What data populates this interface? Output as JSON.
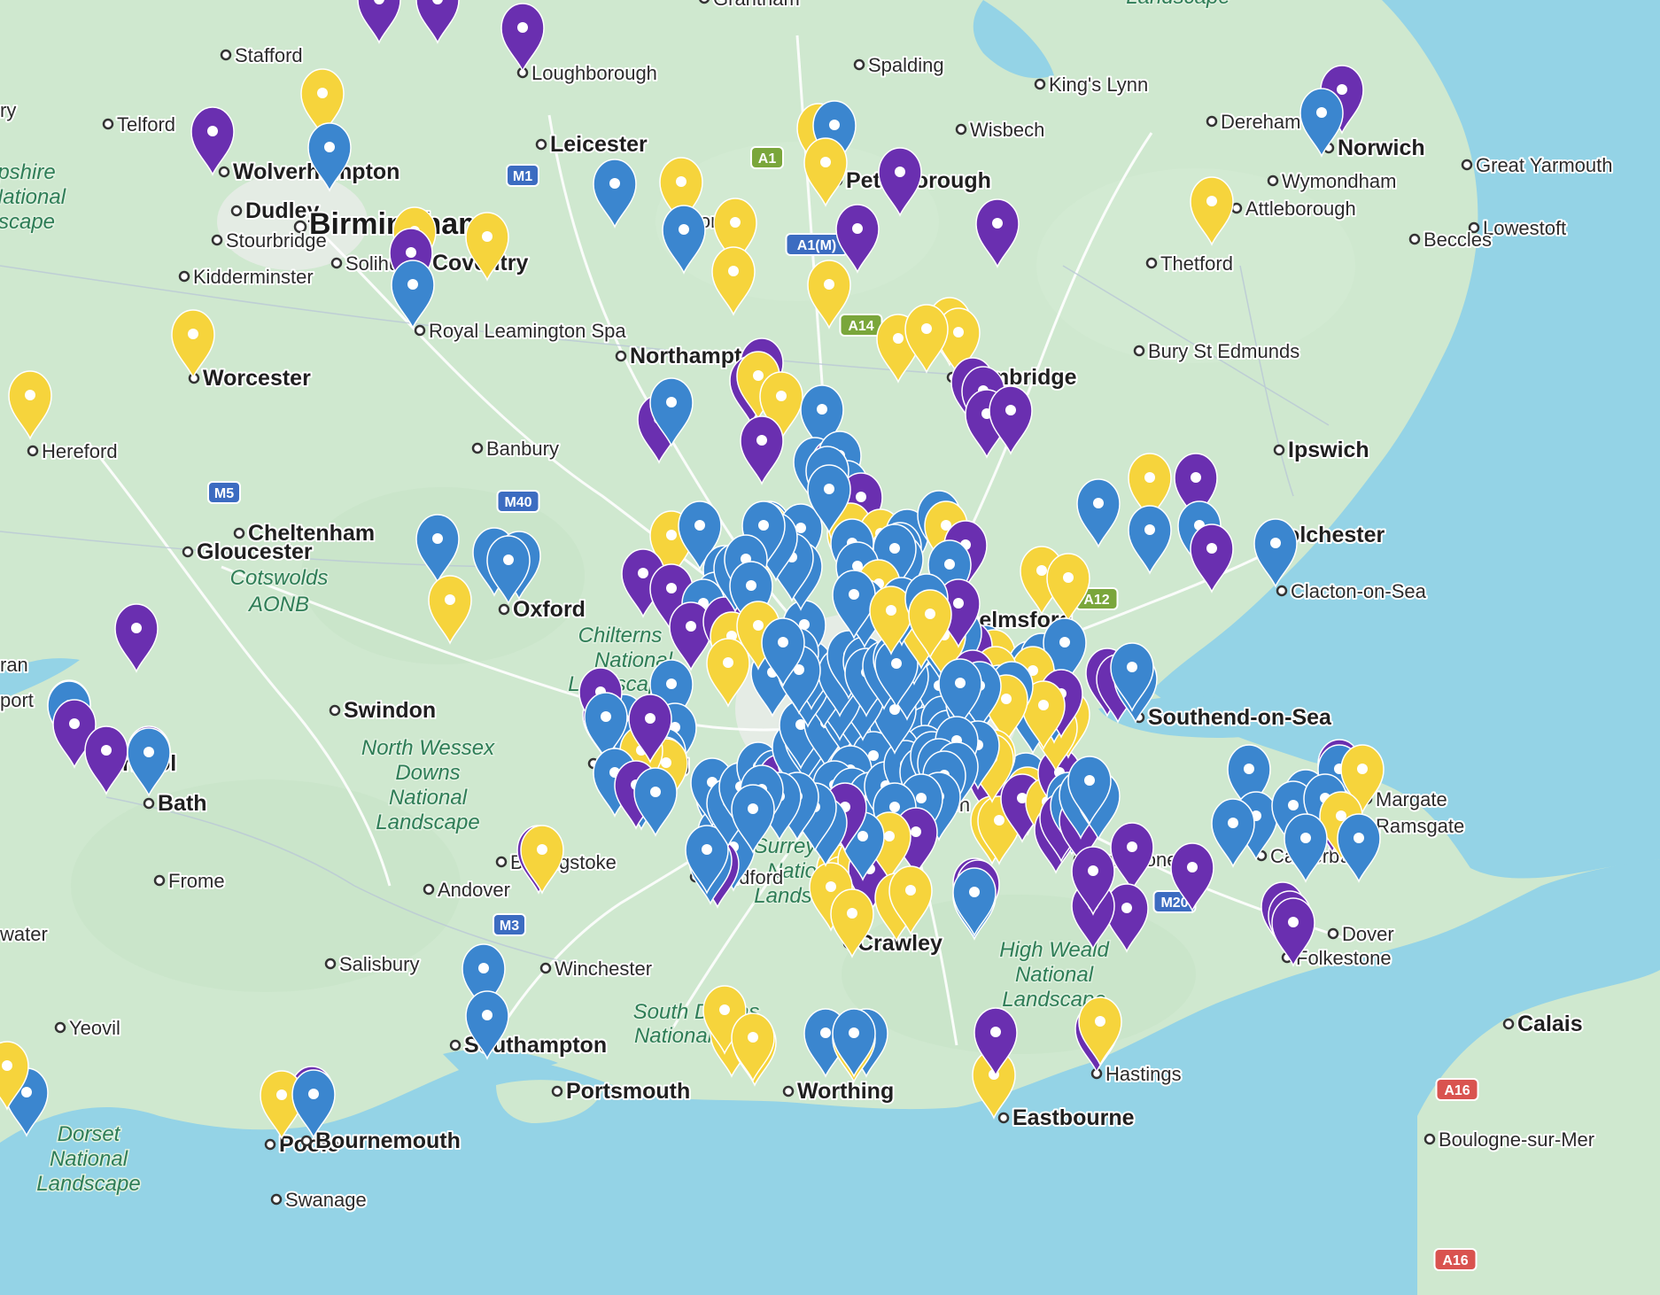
{
  "map": {
    "pin_colors": {
      "purple": "#6a2fb0",
      "blue": "#3b86cf",
      "yellow": "#f6d43c"
    },
    "land_color": "#cfe8cf",
    "water_color": "#94d3e6",
    "places": [
      {
        "name": "Stafford",
        "size": "town"
      },
      {
        "name": "Loughborough",
        "size": "town"
      },
      {
        "name": "Grantham",
        "size": "town"
      },
      {
        "name": "Spalding",
        "size": "town"
      },
      {
        "name": "King's Lynn",
        "size": "town"
      },
      {
        "name": "Telford",
        "size": "town"
      },
      {
        "name": "Leicester",
        "size": "city"
      },
      {
        "name": "Wisbech",
        "size": "town"
      },
      {
        "name": "Dereham",
        "size": "town"
      },
      {
        "name": "Norwich",
        "size": "city"
      },
      {
        "name": "Great Yarmouth",
        "size": "town"
      },
      {
        "name": "Wolverhampton",
        "size": "city"
      },
      {
        "name": "Peterborough",
        "size": "city"
      },
      {
        "name": "Wymondham",
        "size": "town"
      },
      {
        "name": "Dudley",
        "size": "city"
      },
      {
        "name": "Birmingham",
        "size": "big"
      },
      {
        "name": "Corby",
        "size": "town"
      },
      {
        "name": "Attleborough",
        "size": "town"
      },
      {
        "name": "Lowestoft",
        "size": "town"
      },
      {
        "name": "Stourbridge",
        "size": "town"
      },
      {
        "name": "Solihull",
        "size": "town"
      },
      {
        "name": "Coventry",
        "size": "city"
      },
      {
        "name": "Beccles",
        "size": "town"
      },
      {
        "name": "Kidderminster",
        "size": "town"
      },
      {
        "name": "Thetford",
        "size": "town"
      },
      {
        "name": "Royal Leamington Spa",
        "size": "town"
      },
      {
        "name": "Northampton",
        "size": "city"
      },
      {
        "name": "Bury St Edmunds",
        "size": "town"
      },
      {
        "name": "Worcester",
        "size": "city"
      },
      {
        "name": "Cambridge",
        "size": "city"
      },
      {
        "name": "Hereford",
        "size": "town"
      },
      {
        "name": "Banbury",
        "size": "town"
      },
      {
        "name": "Ipswich",
        "size": "city"
      },
      {
        "name": "Cheltenham",
        "size": "city"
      },
      {
        "name": "Colchester",
        "size": "city"
      },
      {
        "name": "Gloucester",
        "size": "city"
      },
      {
        "name": "Oxford",
        "size": "city"
      },
      {
        "name": "Clacton-on-Sea",
        "size": "town"
      },
      {
        "name": "Chelmsford",
        "size": "city"
      },
      {
        "name": "Swindon",
        "size": "city"
      },
      {
        "name": "Southend-on-Sea",
        "size": "city"
      },
      {
        "name": "Reading",
        "size": "city"
      },
      {
        "name": "Bath",
        "size": "city"
      },
      {
        "name": "Margate",
        "size": "town"
      },
      {
        "name": "Ramsgate",
        "size": "town"
      },
      {
        "name": "Croydon",
        "size": "town"
      },
      {
        "name": "Basingstoke",
        "size": "town"
      },
      {
        "name": "Andover",
        "size": "town"
      },
      {
        "name": "Guildford",
        "size": "town"
      },
      {
        "name": "Maidstone",
        "size": "town"
      },
      {
        "name": "Canterbury",
        "size": "town"
      },
      {
        "name": "Frome",
        "size": "town"
      },
      {
        "name": "Dover",
        "size": "town"
      },
      {
        "name": "Crawley",
        "size": "city"
      },
      {
        "name": "Folkestone",
        "size": "town"
      },
      {
        "name": "Salisbury",
        "size": "town"
      },
      {
        "name": "Winchester",
        "size": "town"
      },
      {
        "name": "Calais",
        "size": "city"
      },
      {
        "name": "Yeovil",
        "size": "town"
      },
      {
        "name": "Southampton",
        "size": "city"
      },
      {
        "name": "Hastings",
        "size": "town"
      },
      {
        "name": "Portsmouth",
        "size": "city"
      },
      {
        "name": "Worthing",
        "size": "city"
      },
      {
        "name": "Eastbourne",
        "size": "city"
      },
      {
        "name": "Boulogne-sur-Mer",
        "size": "town"
      },
      {
        "name": "Poole",
        "size": "city"
      },
      {
        "name": "Bournemouth",
        "size": "city"
      },
      {
        "name": "Swanage",
        "size": "town"
      },
      {
        "name": "Bristol",
        "size": "city"
      }
    ],
    "landscapes": [
      "Cotswolds AONB",
      "Chilterns National Landscape",
      "North Wessex Downs National Landscape",
      "Surrey Hills National Landscape",
      "High Weald National Landscape",
      "South Downs National Park",
      "Dorset National Landscape",
      "Shropshire National Landscape",
      "Norfolk Coast National Landscape"
    ],
    "roads": [
      {
        "label": "A1",
        "color": "#7aa63b"
      },
      {
        "label": "A1(M)",
        "color": "#3c6cc1"
      },
      {
        "label": "A14",
        "color": "#7aa63b"
      },
      {
        "label": "M1",
        "color": "#3c6cc1"
      },
      {
        "label": "M40",
        "color": "#3c6cc1"
      },
      {
        "label": "M5",
        "color": "#3c6cc1"
      },
      {
        "label": "M3",
        "color": "#3c6cc1"
      },
      {
        "label": "M20",
        "color": "#3c6cc1"
      },
      {
        "label": "A12",
        "color": "#7aa63b"
      },
      {
        "label": "A16",
        "color": "#d9534f"
      },
      {
        "label": "A16",
        "color": "#d9534f"
      }
    ],
    "partial_labels": [
      "ry",
      "ran",
      "port",
      "water"
    ]
  }
}
